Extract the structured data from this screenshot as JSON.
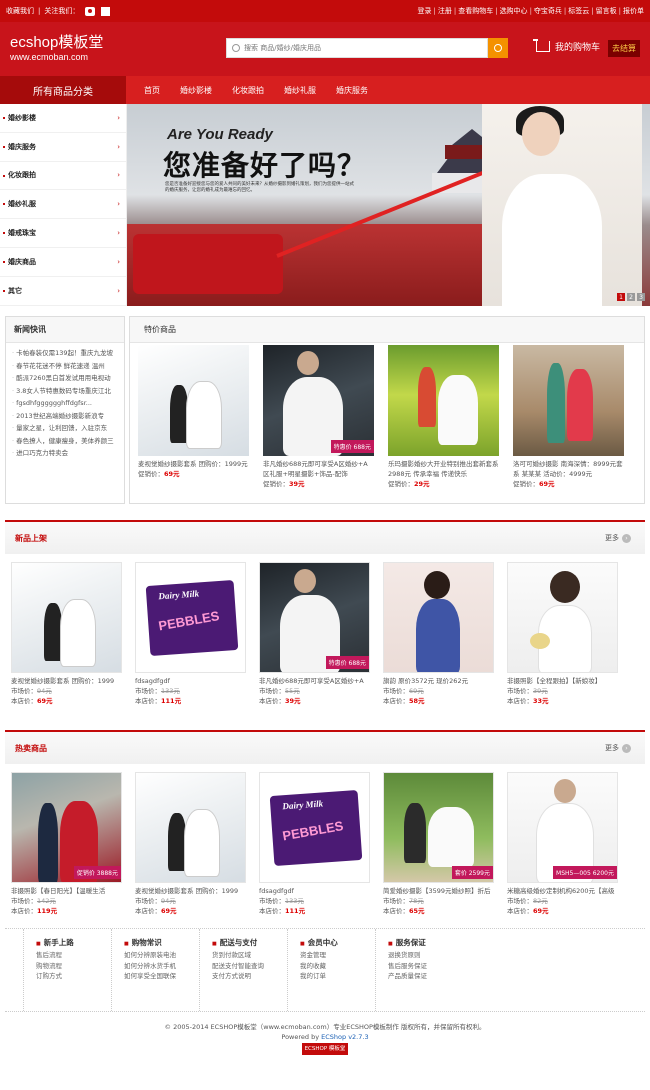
{
  "topbar": {
    "left": [
      "收藏我们",
      "关注我们："
    ],
    "right": [
      "登录",
      "注册",
      "查看购物车",
      "选购中心",
      "夺宝奇兵",
      "标签云",
      "留言板",
      "报价单"
    ]
  },
  "header": {
    "logo_title": "ecshop模板堂",
    "logo_url": "www.ecmoban.com",
    "search_placeholder": "搜索 商品/婚纱/婚庆用品",
    "cart_label": "我的购物车",
    "checkout_label": "去结算"
  },
  "nav": {
    "all_categories": "所有商品分类",
    "items": [
      "首页",
      "婚纱影楼",
      "化妆跟拍",
      "婚纱礼服",
      "婚庆服务"
    ]
  },
  "categories": [
    "婚纱影楼",
    "婚庆服务",
    "化妆跟拍",
    "婚纱礼服",
    "婚戒珠宝",
    "婚庆商品",
    "其它"
  ],
  "banner": {
    "headline_en": "Are You Ready",
    "headline_cn": "您准备好了吗？",
    "body": "您是否准备好迎接您与您的爱人共同的美好未来？从婚纱摄影到婚礼策划，我们为您提供一站式的婚庆服务，让您的婚礼成为最难忘的回忆。",
    "dots": [
      "1",
      "2",
      "3"
    ]
  },
  "news": {
    "title": "新闻快讯",
    "items": [
      "卡帕春装仅需139起！重庆九龙坡",
      "春节花花迷不停 鲜花速递 温州",
      "酷派7260黑白首发试用用电视动",
      "3.8女人节特惠数码专场重庆江北",
      "fgsdhfgggggghffdgfsr...",
      "2013世纪高端婚纱摄影新浪专",
      "量家之星，让利回馈，入驻京东",
      "春色撩人，健康瘦身，美体养颜三",
      "进口巧克力特卖会"
    ]
  },
  "promo": {
    "title": "特价商品",
    "items": [
      {
        "name": "麦视觉婚纱摄影套系 团购价：1999元",
        "price_label": "促销价：",
        "price": "69元"
      },
      {
        "name": "非凡婚纱688元即可享受A区婚纱+A区礼服+明星摄影+饰品-配饰",
        "price_label": "促销价：",
        "price": "39元",
        "tag": "特惠价 688元"
      },
      {
        "name": "乐玛摄影婚纱大开业特别推出套新套系2988元 传承幸福 传递快乐",
        "price_label": "促销价：",
        "price": "29元"
      },
      {
        "name": "洛可可婚纱摄影 南海深情：8999元套系 某某某 活动价：4999元",
        "price_label": "促销价：",
        "price": "69元"
      }
    ]
  },
  "new_arrivals": {
    "title": "新品上架",
    "more": "更多",
    "items": [
      {
        "name": "麦视觉婚纱摄影套系 团购价：1999",
        "market_label": "市场价：",
        "market": "94元",
        "shop_label": "本店价：",
        "shop": "69元"
      },
      {
        "name": "fdsagdfgdf",
        "market_label": "市场价：",
        "market": "133元",
        "shop_label": "本店价：",
        "shop": "111元"
      },
      {
        "name": "非凡婚纱688元即可享受A区婚纱+A",
        "market_label": "市场价：",
        "market": "55元",
        "shop_label": "本店价：",
        "shop": "39元",
        "tag": "特惠价 688元"
      },
      {
        "name": "旗韵 原价3572元 现价262元",
        "market_label": "市场价：",
        "market": "69元",
        "shop_label": "本店价：",
        "shop": "58元"
      },
      {
        "name": "非摄照影【全程跟拍】【新娘妆】",
        "market_label": "市场价：",
        "market": "39元",
        "shop_label": "本店价：",
        "shop": "33元"
      }
    ]
  },
  "hot": {
    "title": "热卖商品",
    "more": "更多",
    "items": [
      {
        "name": "非摄照影【春日阳光】【温暖生活",
        "market_label": "市场价：",
        "market": "142元",
        "shop_label": "本店价：",
        "shop": "119元",
        "tag": "促销价 3888元"
      },
      {
        "name": "麦视觉婚纱摄影套系 团购价：1999",
        "market_label": "市场价：",
        "market": "94元",
        "shop_label": "本店价：",
        "shop": "69元"
      },
      {
        "name": "fdsagdfgdf",
        "market_label": "市场价：",
        "market": "133元",
        "shop_label": "本店价：",
        "shop": "111元"
      },
      {
        "name": "简爱婚纱摄影【3599元婚纱照】折后",
        "market_label": "市场价：",
        "market": "78元",
        "shop_label": "本店价：",
        "shop": "65元",
        "tag": "套价 2599元"
      },
      {
        "name": "米糖高级婚纱定制机构6200元【高级",
        "market_label": "市场价：",
        "market": "82元",
        "shop_label": "本店价：",
        "shop": "69元",
        "tag": "MSH5—005 6200元"
      }
    ]
  },
  "footer": {
    "columns": [
      {
        "title": "新手上路",
        "links": [
          "售后流程",
          "购物流程",
          "订购方式"
        ]
      },
      {
        "title": "购物常识",
        "links": [
          "如何分辨原装电池",
          "如何分辨水货手机",
          "如何享受全国联保"
        ]
      },
      {
        "title": "配送与支付",
        "links": [
          "货到付款区域",
          "配送支付智能查询",
          "支付方式说明"
        ]
      },
      {
        "title": "会员中心",
        "links": [
          "资金管理",
          "我的收藏",
          "我的订单"
        ]
      },
      {
        "title": "服务保证",
        "links": [
          "退换货原则",
          "售后服务保证",
          "产品质量保证"
        ]
      }
    ],
    "copyright": "© 2005-2014 ECSHOP模板堂（www.ecmoban.com）专业ECSHOP模板制作 版权所有，并保留所有权利。",
    "powered_prefix": "Powered by ",
    "powered_brand": "ECShop v2.7.3",
    "badge": "ECSHOP 模板堂"
  }
}
